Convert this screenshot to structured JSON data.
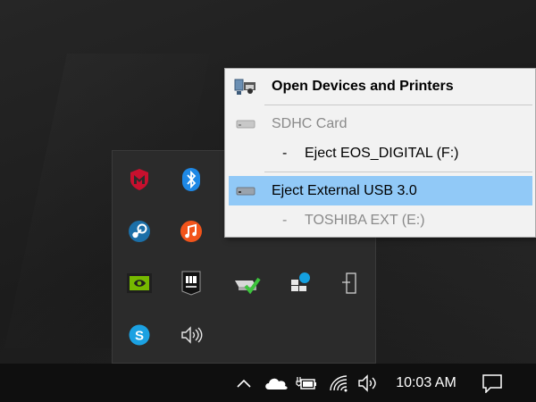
{
  "context_menu": {
    "items": [
      {
        "label": "Open Devices and Printers",
        "icon": "devices-printers-icon"
      },
      {
        "label": "SDHC Card",
        "icon": "drive-icon"
      },
      {
        "dash": "-",
        "label": "Eject EOS_DIGITAL (F:)"
      },
      {
        "label": "Eject External USB 3.0",
        "icon": "drive-icon"
      },
      {
        "dash": "-",
        "label": "TOSHIBA EXT (E:)"
      }
    ],
    "highlight_color": "#91c9f7"
  },
  "tray_flyout": {
    "icons": [
      "mcafee-icon",
      "bluetooth-icon",
      "steam-icon",
      "music-app-icon",
      "nvidia-icon",
      "epic-games-icon",
      "safely-remove-hardware-icon",
      "network-device-icon",
      "usb-drive-icon",
      "skype-icon",
      "volume-icon"
    ]
  },
  "taskbar": {
    "icons": [
      "chevron-up-icon",
      "onedrive-icon",
      "power-battery-icon",
      "wifi-icon",
      "volume-icon",
      "notification-icon"
    ],
    "clock": "10:03 AM"
  }
}
